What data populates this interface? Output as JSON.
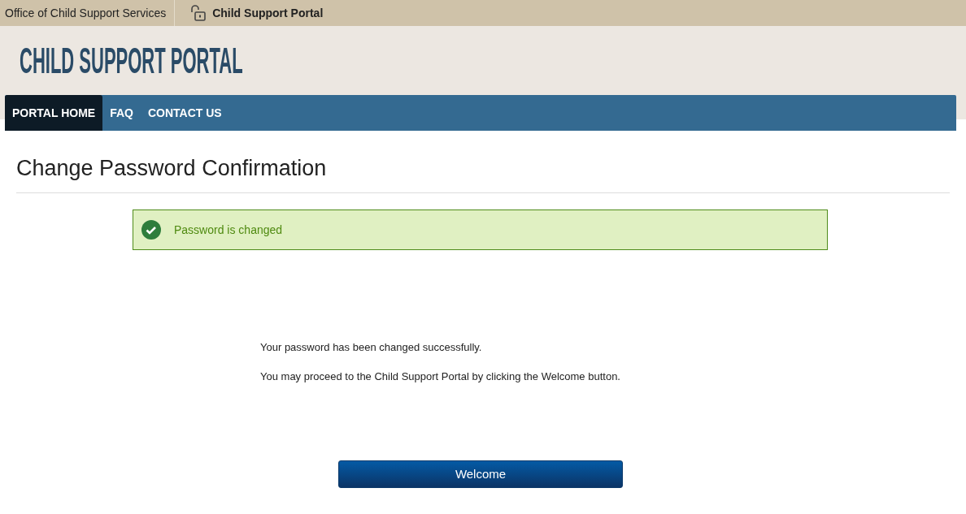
{
  "breadcrumbs": [
    {
      "label": "Office of Child Support Services",
      "kind": "link"
    },
    {
      "label": "Child Support Portal",
      "kind": "current"
    }
  ],
  "logo": "CHILD SUPPORT PORTAL",
  "nav": [
    {
      "label": "PORTAL HOME",
      "selected": true
    },
    {
      "label": "FAQ",
      "selected": false
    },
    {
      "label": "CONTACT US",
      "selected": false
    }
  ],
  "page_title": "Change Password Confirmation",
  "alert": {
    "kind": "success",
    "text": "Password is changed"
  },
  "messages": [
    "Your password has been changed successfully.",
    "You may proceed to the Child Support Portal by clicking the Welcome button."
  ],
  "button": "Welcome"
}
